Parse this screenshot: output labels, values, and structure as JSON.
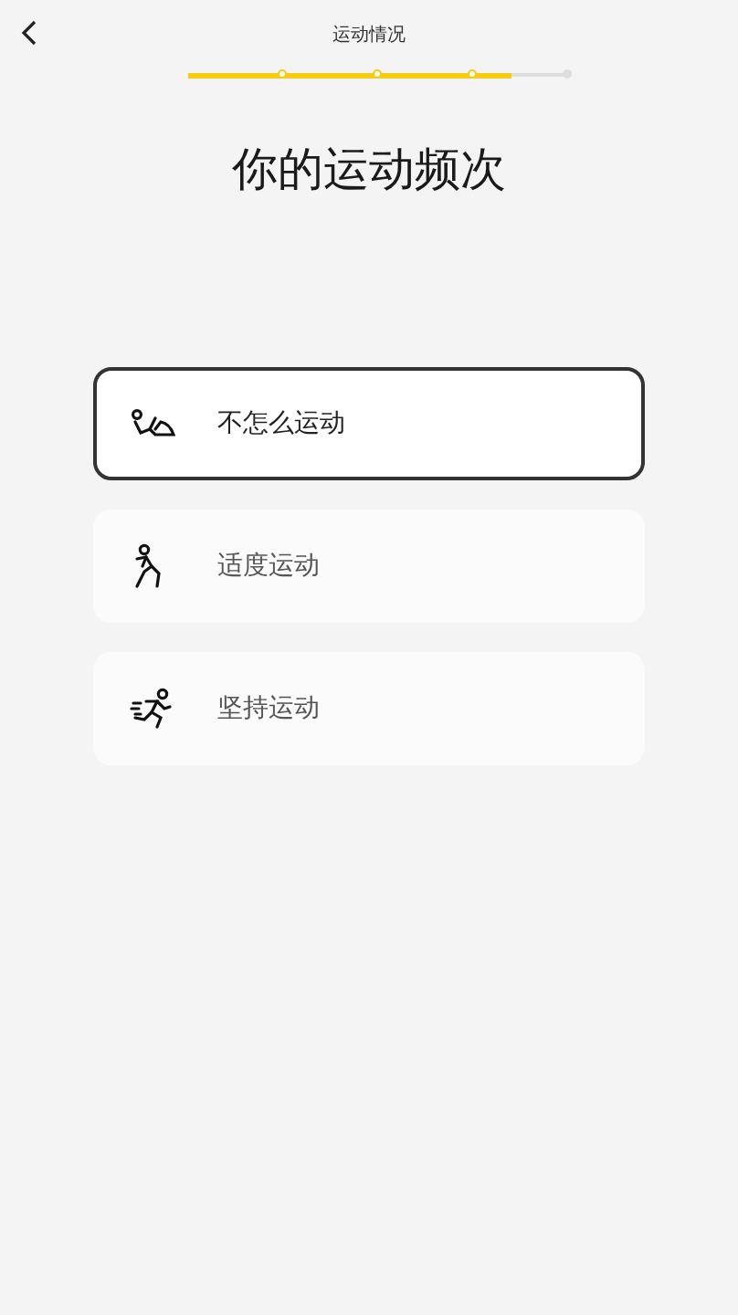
{
  "header": {
    "title": "运动情况"
  },
  "progress": {
    "level": 0.85
  },
  "heading": "你的运动频次",
  "options": [
    {
      "label": "不怎么运动",
      "kind": "rest",
      "selected": true
    },
    {
      "label": "适度运动",
      "kind": "walk",
      "selected": false
    },
    {
      "label": "坚持运动",
      "kind": "run",
      "selected": false
    }
  ]
}
